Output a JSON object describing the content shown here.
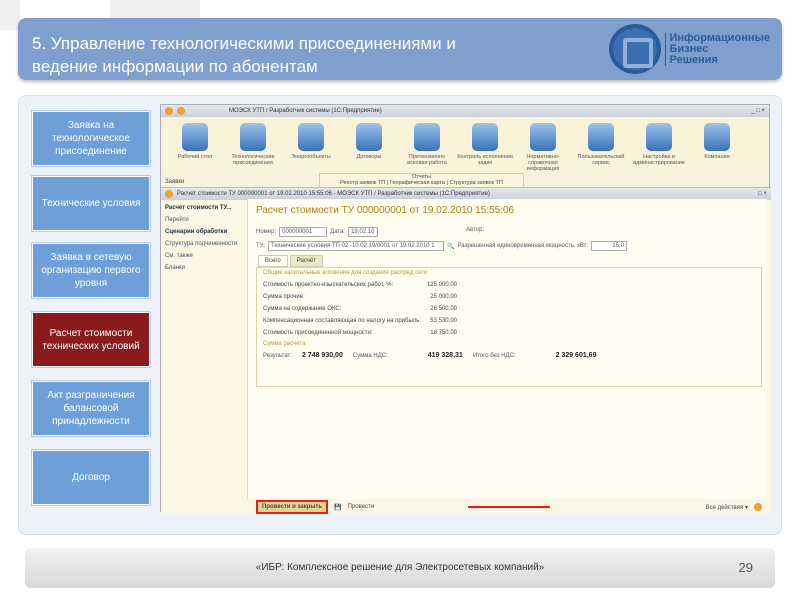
{
  "slide": {
    "title": "5. Управление технологическими присоединениями  и ведение информации по абонентам",
    "logo_text": [
      "Информационные",
      "Бизнес",
      "Решения"
    ],
    "footer": "«ИБР: Комплексное решение для Электросетевых компаний»",
    "page_number": "29"
  },
  "nav": [
    "Заявка на технологическое присоединение",
    "Технические условия",
    "Заявка в сетевую организацию первого уровня",
    "Расчет стоимости технических условий",
    "Акт разграничения балансовой принадлежности",
    "Договор"
  ],
  "app": {
    "window_title": "МОЭСК УТП / Разработчик системы  (1С:Предприятие)",
    "tools": [
      "Рабочий стол",
      "Технологические присоединения",
      "Энергообъекты",
      "Договоры",
      "Претензионно исковая работа",
      "Контроль исполнения задач",
      "Нормативно-справочная информация",
      "Пользовательский сервис",
      "Настройка и администрирование",
      "Компания"
    ],
    "left_section": "Заявки",
    "reports_title": "Отчеты",
    "reports": [
      "Реестр заявок ТП",
      "Георафическая карта",
      "Структура заявок ТП"
    ],
    "doc_window_title": "Расчет стоимости ТУ 000000001 от 19.02.2010 15:55:06 - МОЭСК УТП / Разработчик системы  (1С:Предприятие)",
    "side": {
      "title": "Расчет стоимости ТУ...",
      "goto": "Перейти",
      "links": [
        "Сценарии обработки",
        "Структура подчиненности"
      ],
      "see_also": "См. также",
      "blanks": "Бланки"
    },
    "doc": {
      "title": "Расчет стоимости ТУ 000000001 от 19.02.2010 15:55:06",
      "number_label": "Номер:",
      "number": "000000001",
      "date_label": "Дата:",
      "date": "19.02.10",
      "author_label": "Автор:",
      "tu_label": "ТУ:",
      "tu": "Технические условия ТП 02 -10.02.19/0001 от 19.02.2010 1",
      "power_label": "Разрешенная единовременная мощность, кВт:",
      "power": "15,0",
      "tabs": [
        "Всего",
        "Расчёт"
      ],
      "group1": "Общие капитальные вложения для создания распред сети",
      "items": [
        {
          "label": "Стоимость проектно-изыскательских работ, %:",
          "value": "125 000,00"
        },
        {
          "label": "Сумма прочие:",
          "value": "25 000,00"
        },
        {
          "label": "Сумма на содержание ОКС:",
          "value": "26 500,00"
        },
        {
          "label": "Компенсационная составляющая по налогу на прибыль:",
          "value": "53 530,00"
        },
        {
          "label": "Стоимость присоединенной мощности:",
          "value": "18 750,00"
        }
      ],
      "group2": "Сумма расчета",
      "result_label": "Результат:",
      "result": "2 748 930,00",
      "vat_label": "Сумма НДС:",
      "vat": "419 328,31",
      "novat_label": "Итого без НДС:",
      "novat": "2 329 601,69",
      "post_close": "Провести и закрыть",
      "post": "Провести",
      "all_actions": "Все действия ▾"
    }
  }
}
